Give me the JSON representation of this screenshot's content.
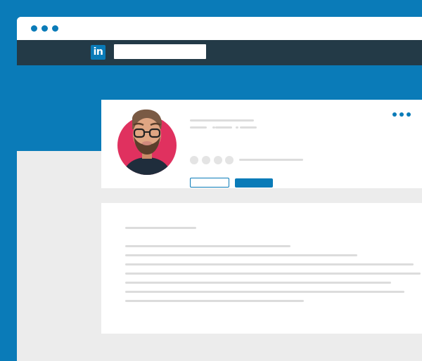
{
  "colors": {
    "brand": "#0a7bb8",
    "navbar": "#233a47",
    "avatar_bg": "#e0315f"
  },
  "window": {
    "controls": [
      "dot",
      "dot",
      "dot"
    ]
  },
  "navbar": {
    "logo_text": "in",
    "search_value": ""
  },
  "profile": {
    "avatar_icon": "bearded-man-glasses-avatar",
    "more_icon": "ellipsis-horizontal-icon"
  }
}
